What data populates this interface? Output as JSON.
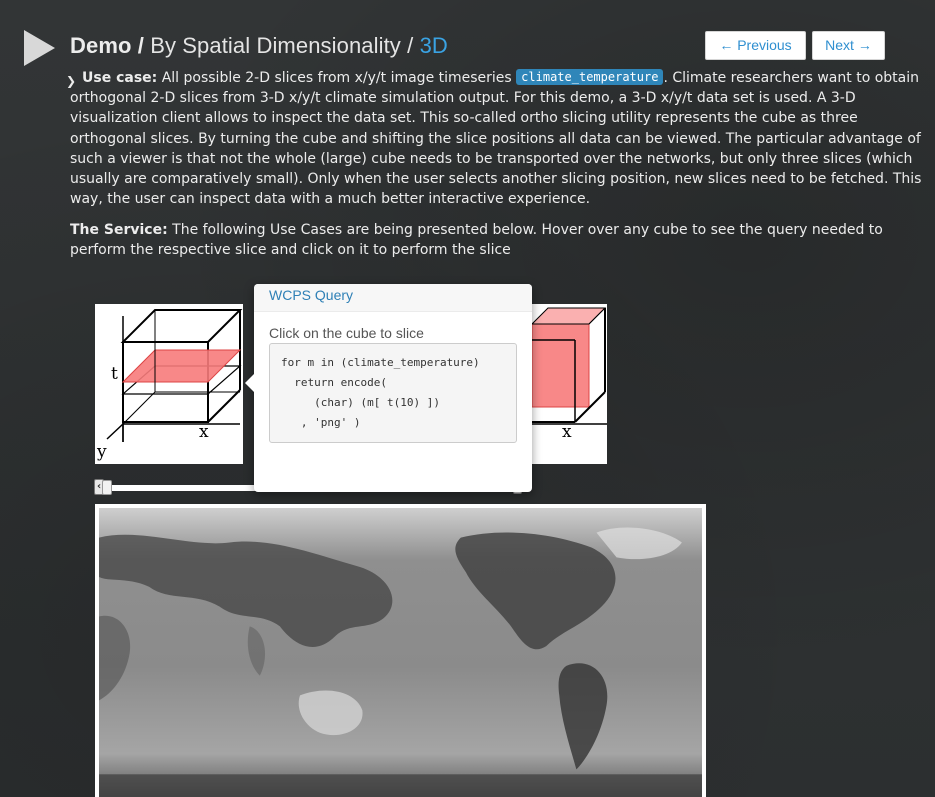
{
  "header": {
    "demo_label": "Demo",
    "separator": "/",
    "crumb": "By Spatial Dimensionality",
    "separator2": "/",
    "current": "3D"
  },
  "nav": {
    "previous": "← Previous",
    "next": "Next →"
  },
  "use_case": {
    "heading": "Use case:",
    "intro": "All possible 2-D slices from x/y/t image timeseries",
    "coverage": "climate_temperature",
    "body": ". Climate researchers want to obtain orthogonal 2-D slices from 3-D x/y/t climate simulation output. For this demo, a 3-D x/y/t data set is used. A 3-D visualization client allows to inspect the data set. This so-called ortho slicing utility represents the cube as three orthogonal slices. By turning the cube and shifting the slice positions all data can be viewed. The particular advantage of such a viewer is that not the whole (large) cube needs to be transported over the networks, but only three slices (which usually are comparatively small). Only when the user selects another slicing position, new slices need to be fetched. This way, the user can inspect data with a much better interactive experience."
  },
  "service": {
    "heading": "The Service:",
    "body": "The following Use Cases are being presented below. Hover over any cube to see the query needed to perform the respective slice and click on it to perform the slice"
  },
  "cube_left": {
    "axis_t": "t",
    "axis_x": "x",
    "axis_y": "y"
  },
  "cube_right": {
    "axis_x": "x"
  },
  "popover": {
    "title": "WCPS Query",
    "hint": "Click on the cube to slice",
    "query": "for m in (climate_temperature)\n  return encode(\n     (char) (m[ t(10) ])\n   , 'png' )"
  },
  "colors": {
    "accent": "#3aa3e3",
    "slice_fill": "#f77b7b",
    "badge": "#2f86b9"
  }
}
